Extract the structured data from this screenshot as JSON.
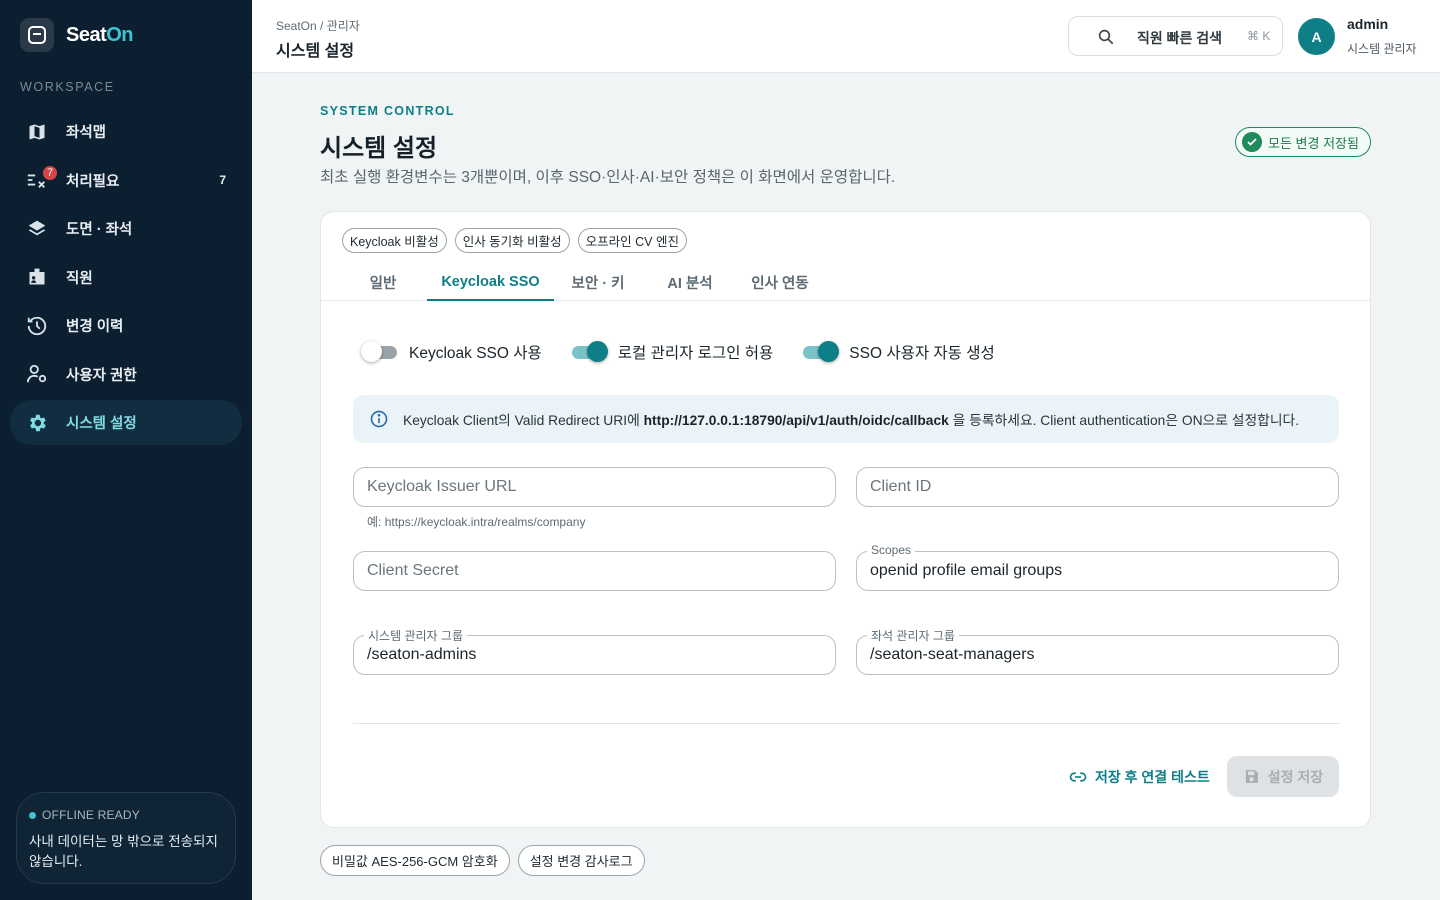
{
  "brand": {
    "name_a": "Seat",
    "name_b": "On"
  },
  "sidebar": {
    "section_label": "WORKSPACE",
    "items": [
      {
        "label": "좌석맵",
        "icon": "map-icon"
      },
      {
        "label": "처리필요",
        "icon": "tasks-icon",
        "badge": "7",
        "count": "7"
      },
      {
        "label": "도면 · 좌석",
        "icon": "layers-icon"
      },
      {
        "label": "직원",
        "icon": "id-badge-icon"
      },
      {
        "label": "변경 이력",
        "icon": "history-icon"
      },
      {
        "label": "사용자 권한",
        "icon": "user-cog-icon"
      },
      {
        "label": "시스템 설정",
        "icon": "gear-icon",
        "active": true
      }
    ],
    "offline": {
      "title": "OFFLINE READY",
      "text": "사내 데이터는 망 밖으로 전송되지 않습니다."
    }
  },
  "header": {
    "breadcrumb": "SeatOn / 관리자",
    "title": "시스템 설정",
    "search": {
      "label": "직원 빠른 검색",
      "shortcut": "⌘ K"
    },
    "user": {
      "initial": "A",
      "name": "admin",
      "role": "시스템 관리자"
    }
  },
  "page": {
    "eyebrow": "SYSTEM CONTROL",
    "title": "시스템 설정",
    "description": "최초 실행 환경변수는 3개뿐이며, 이후 SSO·인사·AI·보안 정책은 이 화면에서 운영합니다.",
    "saved_status": "모든 변경 저장됨"
  },
  "status_chips": [
    "Keycloak 비활성",
    "인사 동기화 비활성",
    "오프라인 CV 엔진"
  ],
  "tabs": [
    {
      "label": "일반"
    },
    {
      "label": "Keycloak SSO",
      "active": true
    },
    {
      "label": "보안 · 키"
    },
    {
      "label": "AI 분석"
    },
    {
      "label": "인사 연동"
    }
  ],
  "toggles": [
    {
      "label": "Keycloak SSO 사용",
      "on": false
    },
    {
      "label": "로컬 관리자 로그인 허용",
      "on": true
    },
    {
      "label": "SSO 사용자 자동 생성",
      "on": true
    }
  ],
  "info": {
    "prefix": "Keycloak Client의 Valid Redirect URI에 ",
    "url": "http://127.0.0.1:18790/api/v1/auth/oidc/callback",
    "suffix": " 을 등록하세요. Client authentication은 ON으로 설정합니다."
  },
  "fields": {
    "issuer": {
      "placeholder": "Keycloak Issuer URL",
      "value": "",
      "helper": "예: https://keycloak.intra/realms/company"
    },
    "client_id": {
      "placeholder": "Client ID",
      "value": ""
    },
    "client_secret": {
      "placeholder": "Client Secret",
      "value": ""
    },
    "scopes": {
      "label": "Scopes",
      "value": "openid profile email groups"
    },
    "admin_group": {
      "label": "시스템 관리자 그룹",
      "value": "/seaton-admins"
    },
    "seat_manager_group": {
      "label": "좌석 관리자 그룹",
      "value": "/seaton-seat-managers"
    }
  },
  "actions": {
    "test": "저장 후 연결 테스트",
    "save": "설정 저장"
  },
  "footer_chips": [
    "비밀값 AES-256-GCM 암호화",
    "설정 변경 감사로그"
  ],
  "colors": {
    "accent": "#0f7f87",
    "sidebar_bg": "#0c1f30",
    "success": "#1f8b5a",
    "badge": "#d64545"
  }
}
